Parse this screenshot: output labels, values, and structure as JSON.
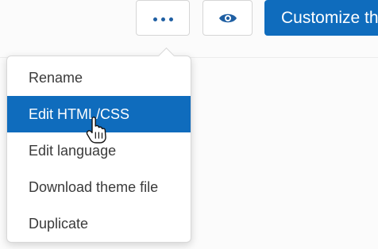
{
  "toolbar": {
    "more_icon": "more-horizontal-icon",
    "preview_icon": "eye-icon",
    "primary_label": "Customize th"
  },
  "menu": {
    "items": [
      {
        "label": "Rename",
        "active": false
      },
      {
        "label": "Edit HTML/CSS",
        "active": true
      },
      {
        "label": "Edit language",
        "active": false
      },
      {
        "label": "Download theme file",
        "active": false
      },
      {
        "label": "Duplicate",
        "active": false
      }
    ]
  },
  "colors": {
    "accent": "#0f6cbd",
    "dots": "#1f5fa3",
    "menu_text": "#3a3a3a",
    "border": "#d6d6d6"
  },
  "cursor_icon": "hand-pointer-icon"
}
